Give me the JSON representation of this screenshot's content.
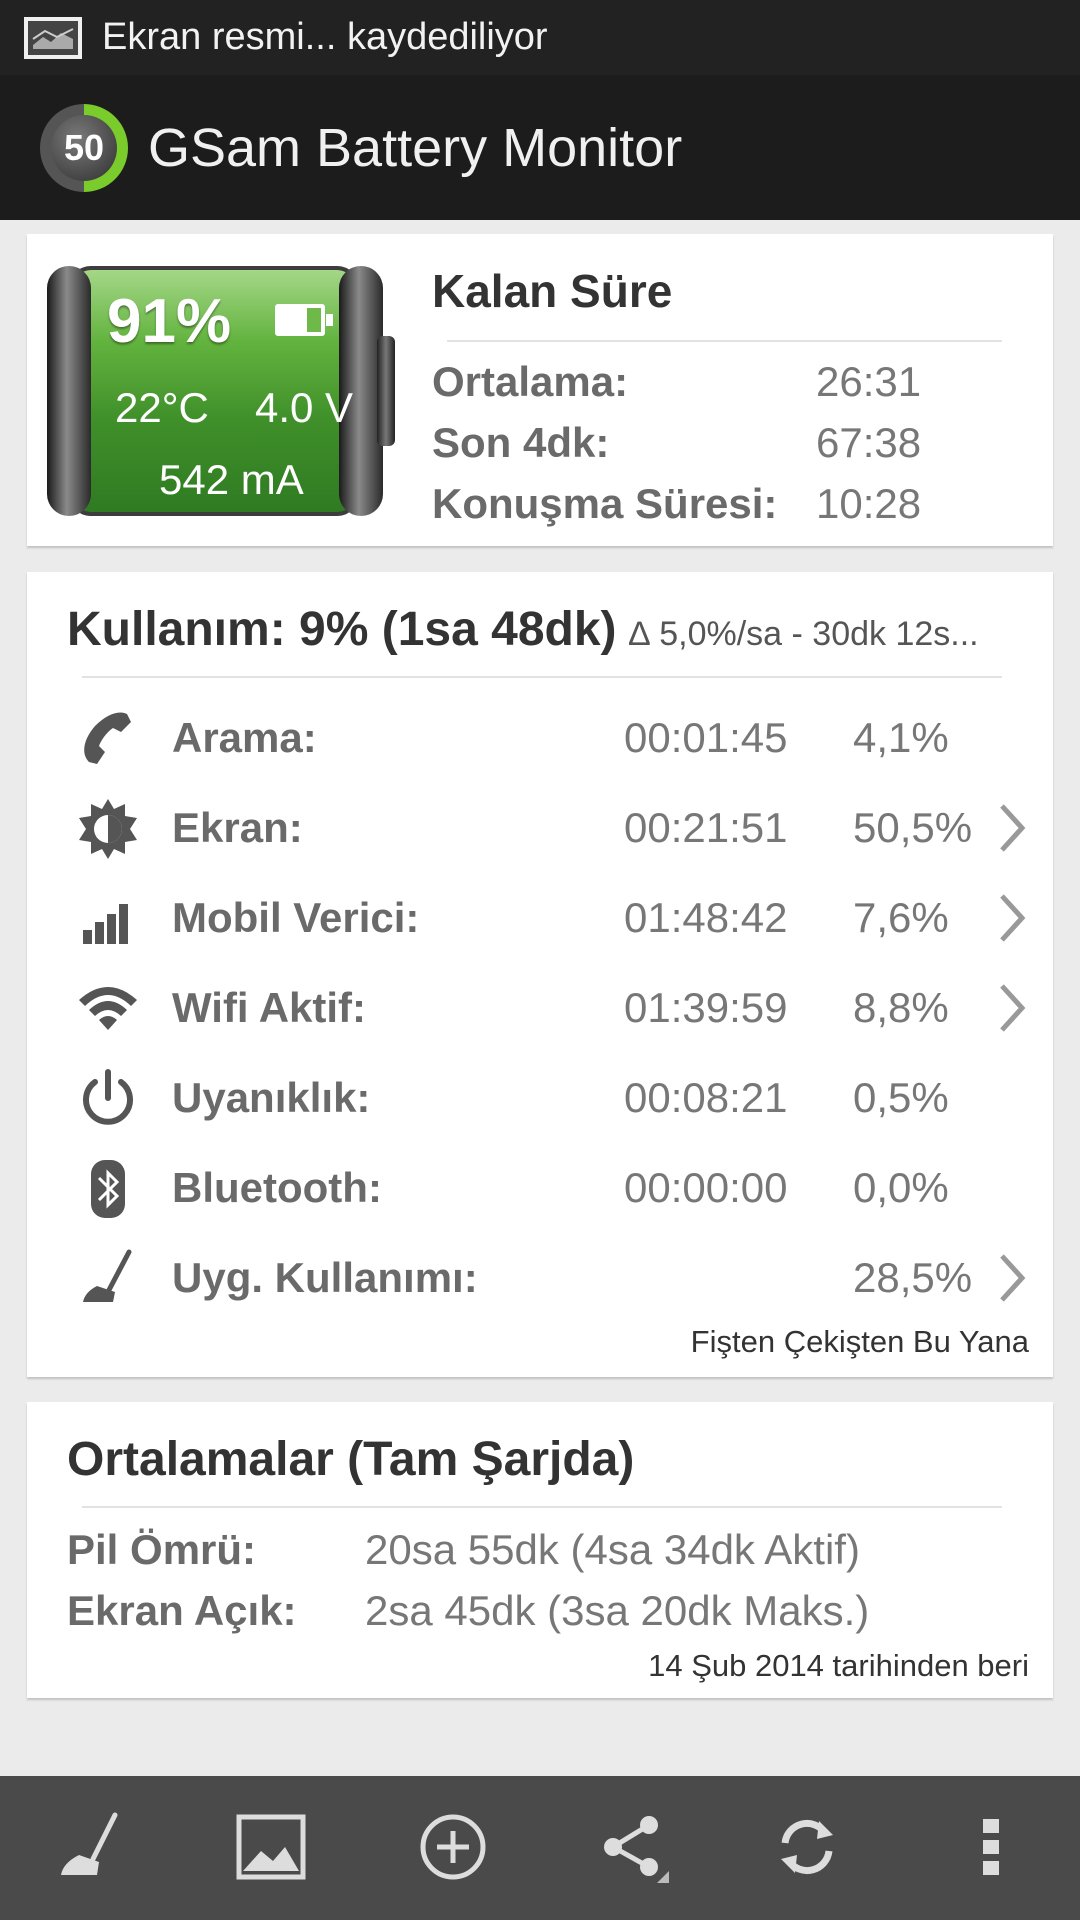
{
  "status_bar": {
    "notification_text": "Ekran resmi... kaydediliyor"
  },
  "action_bar": {
    "logo_value": "50",
    "title": "GSam Battery Monitor"
  },
  "battery": {
    "percent": "91%",
    "temperature": "22°C",
    "voltage": "4.0 V",
    "current": "542 mA"
  },
  "remaining": {
    "title": "Kalan Süre",
    "rows": [
      {
        "label": "Ortalama:",
        "value": "26:31"
      },
      {
        "label": "Son 4dk:",
        "value": "67:38"
      },
      {
        "label": "Konuşma Süresi:",
        "value": "10:28"
      }
    ]
  },
  "usage": {
    "title": "Kullanım: 9% (1sa 48dk)",
    "delta": "∆ 5,0%/sa - 30dk 12s...",
    "rows": [
      {
        "icon": "phone-icon",
        "label": "Arama:",
        "time": "00:01:45",
        "percent": "4,1%",
        "has_detail": false
      },
      {
        "icon": "brightness-icon",
        "label": "Ekran:",
        "time": "00:21:51",
        "percent": "50,5%",
        "has_detail": true
      },
      {
        "icon": "signal-bars-icon",
        "label": "Mobil Verici:",
        "time": "01:48:42",
        "percent": "7,6%",
        "has_detail": true
      },
      {
        "icon": "wifi-icon",
        "label": "Wifi Aktif:",
        "time": "01:39:59",
        "percent": "8,8%",
        "has_detail": true
      },
      {
        "icon": "power-icon",
        "label": "Uyanıklık:",
        "time": "00:08:21",
        "percent": "0,5%",
        "has_detail": false
      },
      {
        "icon": "bluetooth-icon",
        "label": "Bluetooth:",
        "time": "00:00:00",
        "percent": "0,0%",
        "has_detail": false
      },
      {
        "icon": "broom-icon",
        "label": "Uyg. Kullanımı:",
        "time": "",
        "percent": "28,5%",
        "has_detail": true
      }
    ],
    "footer": "Fişten Çekişten Bu Yana"
  },
  "averages": {
    "title": "Ortalamalar (Tam Şarjda)",
    "rows": [
      {
        "label": "Pil Ömrü:",
        "value": "20sa 55dk (4sa 34dk Aktif)"
      },
      {
        "label": "Ekran Açık:",
        "value": "2sa 45dk (3sa 20dk Maks.)"
      }
    ],
    "footer": "14 Şub 2014 tarihinden beri"
  },
  "toolbar": {
    "buttons": [
      "broom-icon",
      "image-icon",
      "add-circle-icon",
      "share-icon",
      "refresh-icon",
      "overflow-menu-icon"
    ]
  },
  "colors": {
    "battery_green": "#3f8f2a",
    "logo_ring": "#7acb2c",
    "toolbar_bg": "#4a4a4a",
    "actionbar_bg": "#1c1c1c"
  }
}
